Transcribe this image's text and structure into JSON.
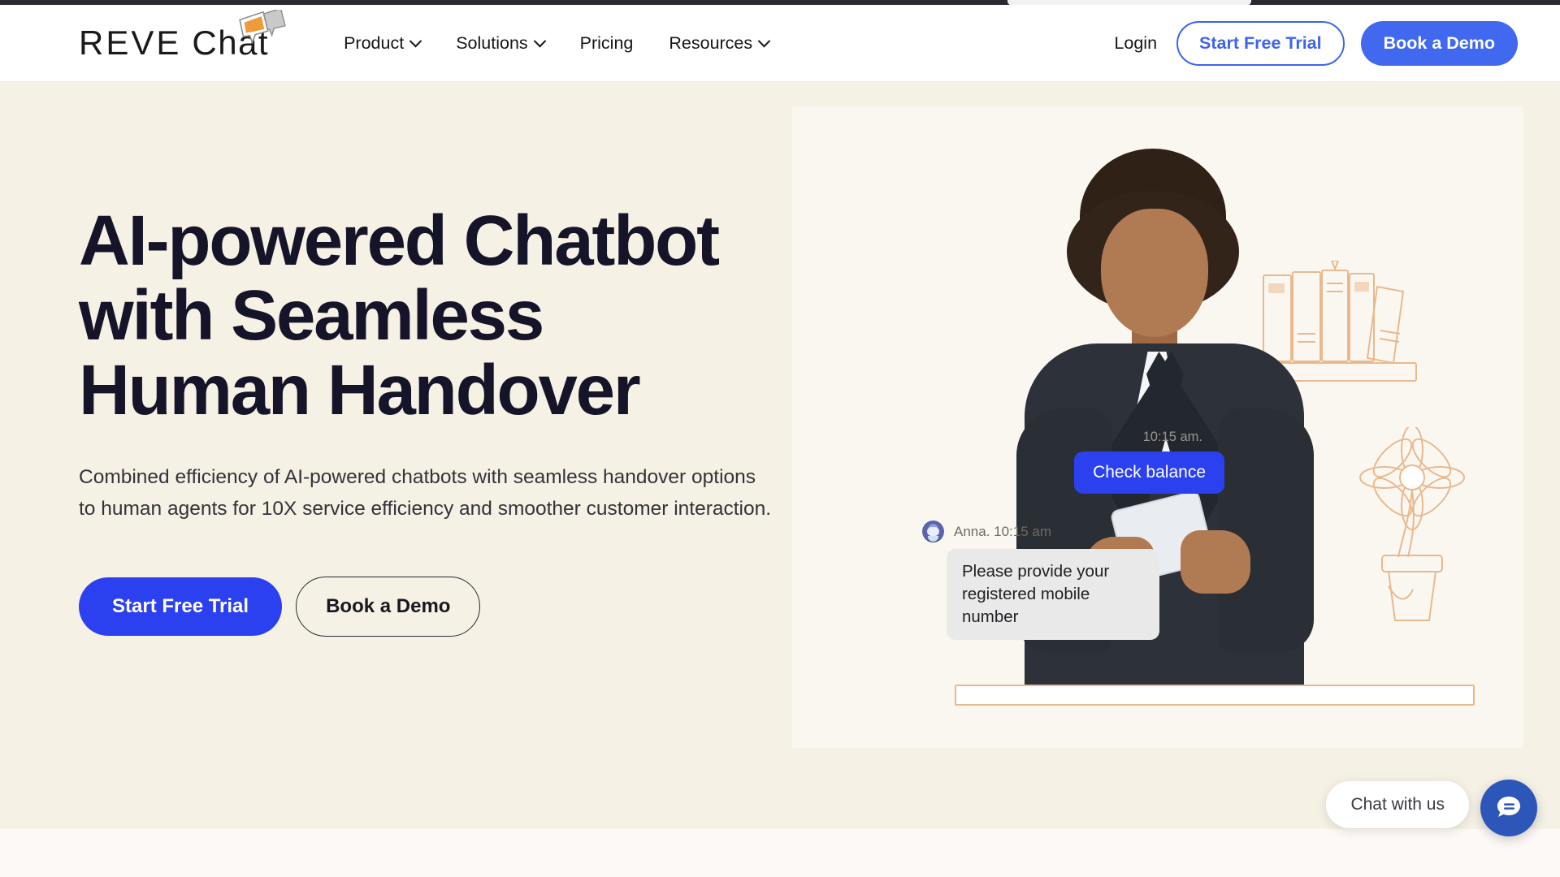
{
  "brand": {
    "logo_text_part1": "REVE",
    "logo_text_part2": "Chat",
    "logo_icon": "speech-bubbles-icon",
    "accent_blue": "#2b41f0",
    "header_blue": "#4169ef",
    "outline_blue": "#3d64f0",
    "hero_bg": "#F5F1E5",
    "hero_card_bg": "#FAF7F0",
    "bottom_band_bg": "#FDF9F7",
    "line_art_color": "#E9B98E",
    "widget_blue": "#2c56b8"
  },
  "header": {
    "nav": [
      {
        "label": "Product",
        "has_dropdown": true
      },
      {
        "label": "Solutions",
        "has_dropdown": true
      },
      {
        "label": "Pricing",
        "has_dropdown": false
      },
      {
        "label": "Resources",
        "has_dropdown": true
      }
    ],
    "login_label": "Login",
    "trial_button_label": "Start Free Trial",
    "demo_button_label": "Book a Demo"
  },
  "hero": {
    "title_line1": "AI-powered Chatbot",
    "title_line2": "with Seamless",
    "title_line3": "Human Handover",
    "subtitle": "Combined efficiency of AI-powered chatbots with seamless handover options to human agents for 10X service efficiency and smoother customer interaction.",
    "primary_cta": "Start Free Trial",
    "secondary_cta": "Book a Demo"
  },
  "hero_chat": {
    "outgoing_time": "10:15 am.",
    "outgoing_message": "Check balance",
    "agent_meta": "Anna. 10:15 am",
    "incoming_message": "Please provide your registered mobile number",
    "avatar_icon": "robot-avatar-icon"
  },
  "chat_widget": {
    "pill_label": "Chat with us",
    "fab_icon": "chat-bubble-icon"
  }
}
